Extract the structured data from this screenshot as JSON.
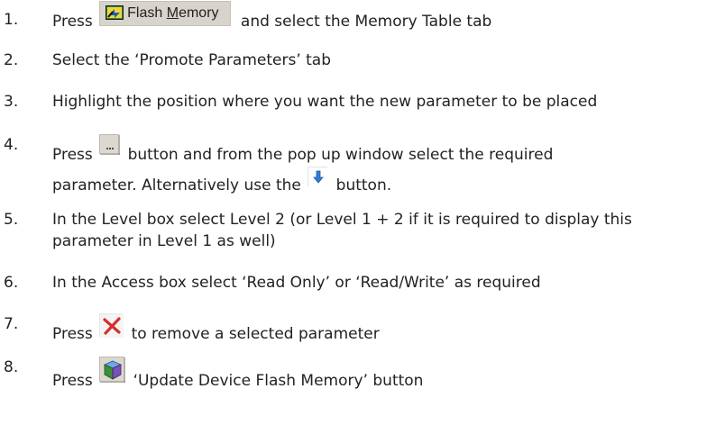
{
  "steps": [
    {
      "number": "1.",
      "before": "Press",
      "button_label_pre": "Flash ",
      "button_label_accel": "M",
      "button_label_post": "emory",
      "after": "and select the Memory Table tab"
    },
    {
      "number": "2.",
      "text": "Select the ‘Promote Parameters’ tab"
    },
    {
      "number": "3.",
      "text": "Highlight the position where you want the new parameter to be placed"
    },
    {
      "number": "4.",
      "before": "Press",
      "after": "button and from the pop up window select the required",
      "line2_before": "parameter.  Alternatively use the",
      "line2_after": "button."
    },
    {
      "number": "5.",
      "text": "In the Level box select Level 2 (or Level 1 + 2 if it is required to display this parameter in Level 1 as well)"
    },
    {
      "number": "6.",
      "text": "In the Access box select ‘Read Only’ or ‘Read/Write’ as required"
    },
    {
      "number": "7.",
      "before": "Press",
      "after": "to remove a selected parameter"
    },
    {
      "number": "8.",
      "before": "Press",
      "after": "‘Update Device Flash Memory’ button"
    }
  ],
  "icons": {
    "flash_memory": "flash-memory-icon",
    "browse": "ellipsis-button-icon",
    "insert": "blue-down-arrow-icon",
    "remove": "red-cross-icon",
    "update": "update-device-icon"
  },
  "colors": {
    "text": "#222222",
    "button_face": "#d8d4cc",
    "arrow_blue": "#2f7fd6",
    "cross_red": "#d2302c",
    "flash_icon_green": "#2e8b3a"
  }
}
